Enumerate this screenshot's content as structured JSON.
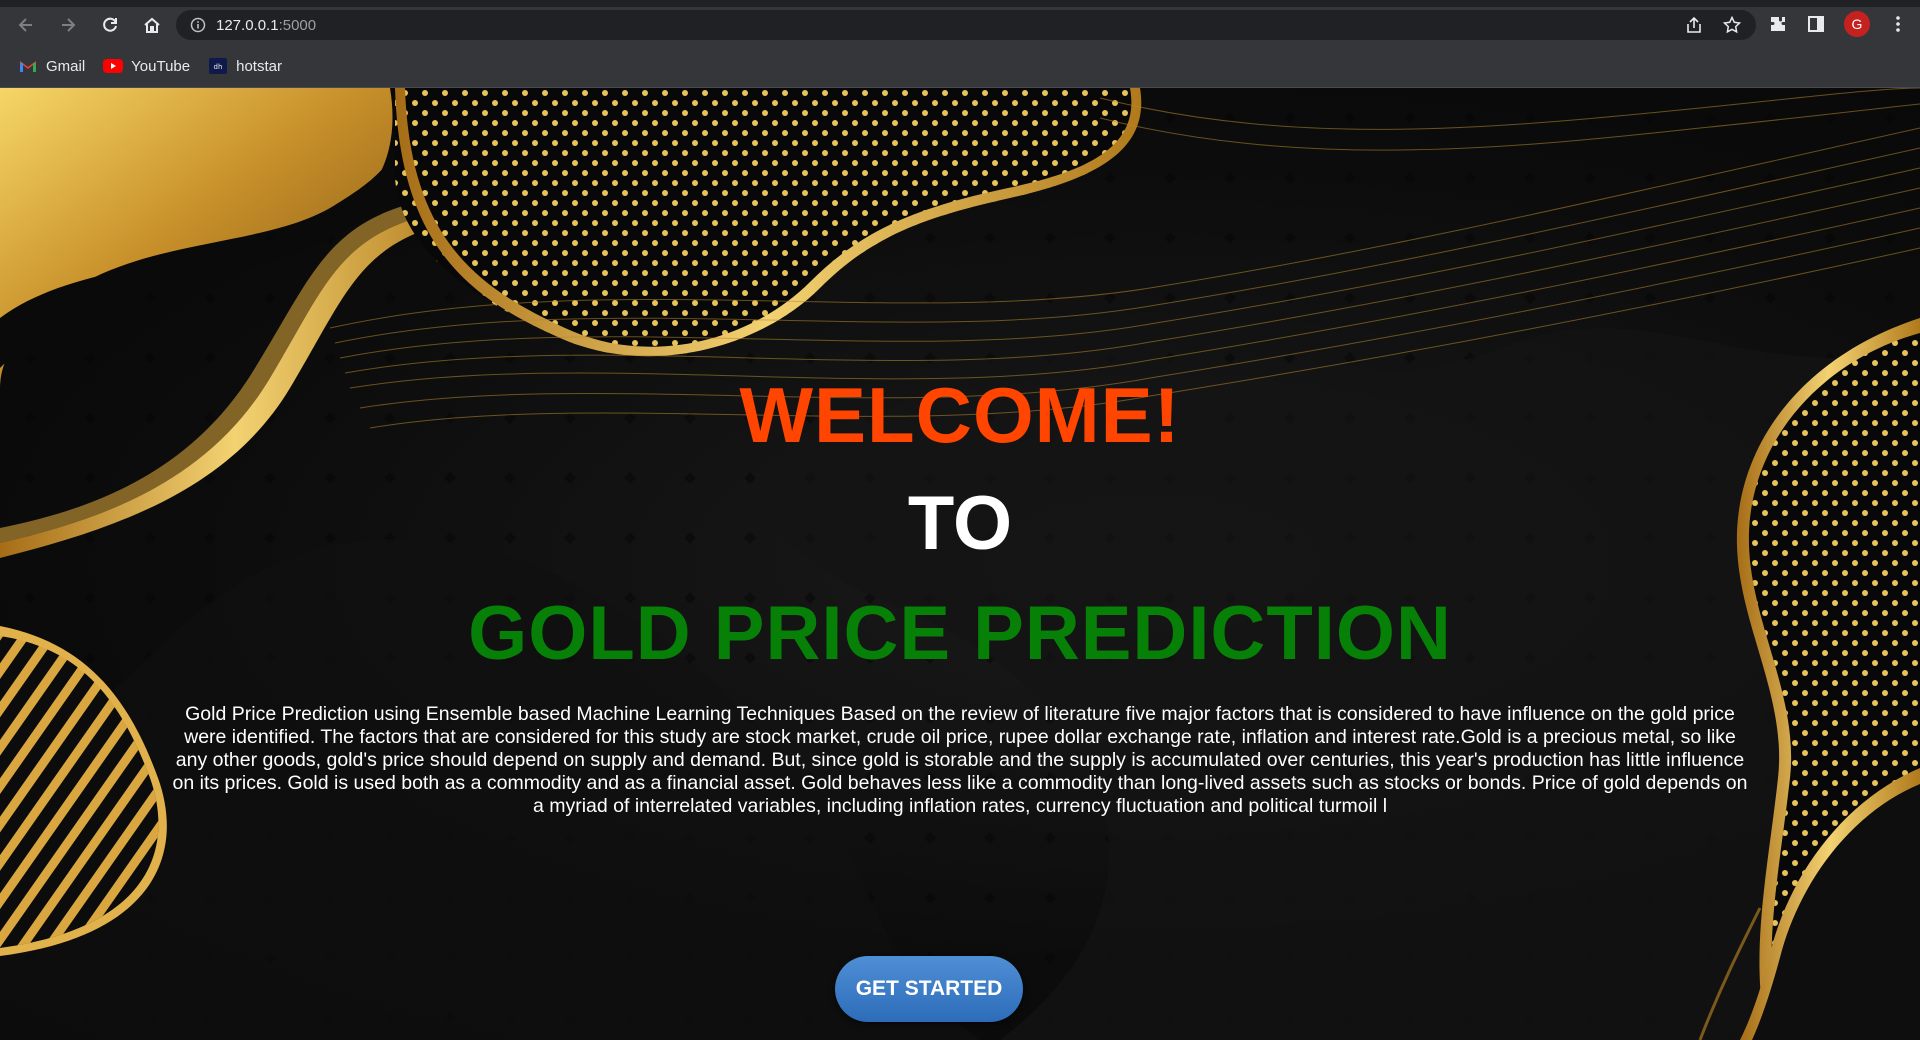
{
  "browser": {
    "url_host": "127.0.0.1",
    "url_port": ":5000",
    "avatar_letter": "G",
    "bookmarks": [
      {
        "label": "Gmail",
        "icon": "gmail-icon"
      },
      {
        "label": "YouTube",
        "icon": "youtube-icon"
      },
      {
        "label": "hotstar",
        "icon": "hotstar-icon"
      }
    ]
  },
  "hero": {
    "welcome": "WELCOME!",
    "to": "TO",
    "title": "GOLD PRICE PREDICTION",
    "description": "Gold Price Prediction using Ensemble based Machine Learning Techniques Based on the review of literature five major factors that is considered to have influence on the gold price were identified. The factors that are considered for this study are stock market, crude oil price, rupee dollar exchange rate, inflation and interest rate.Gold is a precious metal, so like any other goods, gold's price should depend on supply and demand. But, since gold is storable and the supply is accumulated over centuries, this year's production has little influence on its prices. Gold is used both as a commodity and as a financial asset. Gold behaves less like a commodity than long-lived assets such as stocks or bonds. Price of gold depends on a myriad of interrelated variables, including inflation rates, currency fluctuation and political turmoil l",
    "cta": "GET STARTED"
  },
  "colors": {
    "welcome": "#ff4500",
    "title": "#068006",
    "gold": "#d4a63a",
    "button": "#3b7cc9"
  }
}
